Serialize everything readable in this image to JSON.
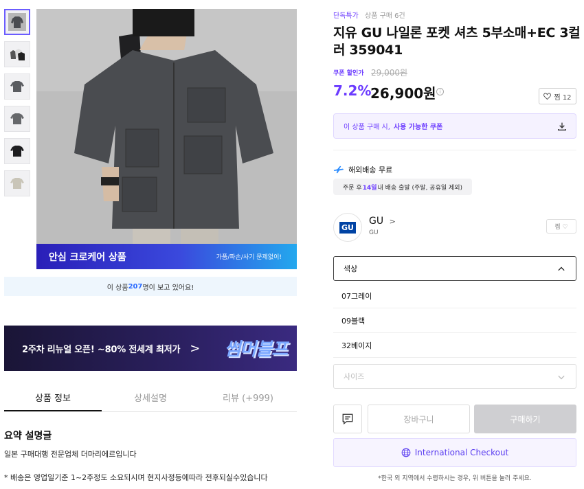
{
  "gallery": {
    "thumbs": [
      "thumb-1",
      "thumb-2",
      "thumb-3",
      "thumb-4",
      "thumb-5",
      "thumb-6"
    ],
    "care_title": "안심 크로케어 상품",
    "care_sub": "가품/파손/사기 문제없이!",
    "viewing_prefix": "이 상품 ",
    "viewing_count": "207",
    "viewing_suffix": "명이 보고 있어요!"
  },
  "banner": {
    "text": "2주차 리뉴얼 오픈! ~80% 전세계 최저가",
    "arrow": ">",
    "logo": "썸머블프"
  },
  "tabs": [
    "상품 정보",
    "상세설명",
    "리뷰 (+999)"
  ],
  "summary": {
    "title": "요약 설명글",
    "line1": "일본 구매대행 전문업체 더마리에르입니다",
    "line2": "* 배송은 영업일기준 1~2주정도 소요되시며 현지사정등에따라 전후되실수있습니다"
  },
  "product": {
    "tag1": "단독특가",
    "tag2": "상품 구매 6건",
    "title": "지유 GU 나일론 포켓 셔츠 5부소매+EC 3컬러 359041",
    "coupon_label": "쿠폰 할인가",
    "original_price": "29,000원",
    "discount": "7.2%",
    "price": "26,900원",
    "wish_label": "찜 12"
  },
  "coupon": {
    "prefix": "이 상품 구매 시,",
    "bold": "사용 가능한 쿠폰"
  },
  "shipping": {
    "label": "해외배송 무료",
    "note_prefix": "주문 후 ",
    "note_days": "14일",
    "note_suffix": " 내 배송 출발 (주말, 공휴일 제외)"
  },
  "brand": {
    "logo": "GU",
    "name": "GU",
    "arrow": ">",
    "sub": "GU",
    "wish": "찜 ♡"
  },
  "options": {
    "color_label": "색상",
    "colors": [
      "07그레이",
      "09블랙",
      "32베이지"
    ],
    "size_label": "사이즈"
  },
  "actions": {
    "cart": "장바구니",
    "buy": "구매하기",
    "intl": "International Checkout",
    "intl_note": "*한국 외 지역에서 수령하시는 경우, 위 버튼을 눌러 주세요."
  },
  "colors": {
    "accent": "#6b3bff",
    "shirt": "#4a4c50",
    "buy_disabled": "#cfcfd2"
  }
}
